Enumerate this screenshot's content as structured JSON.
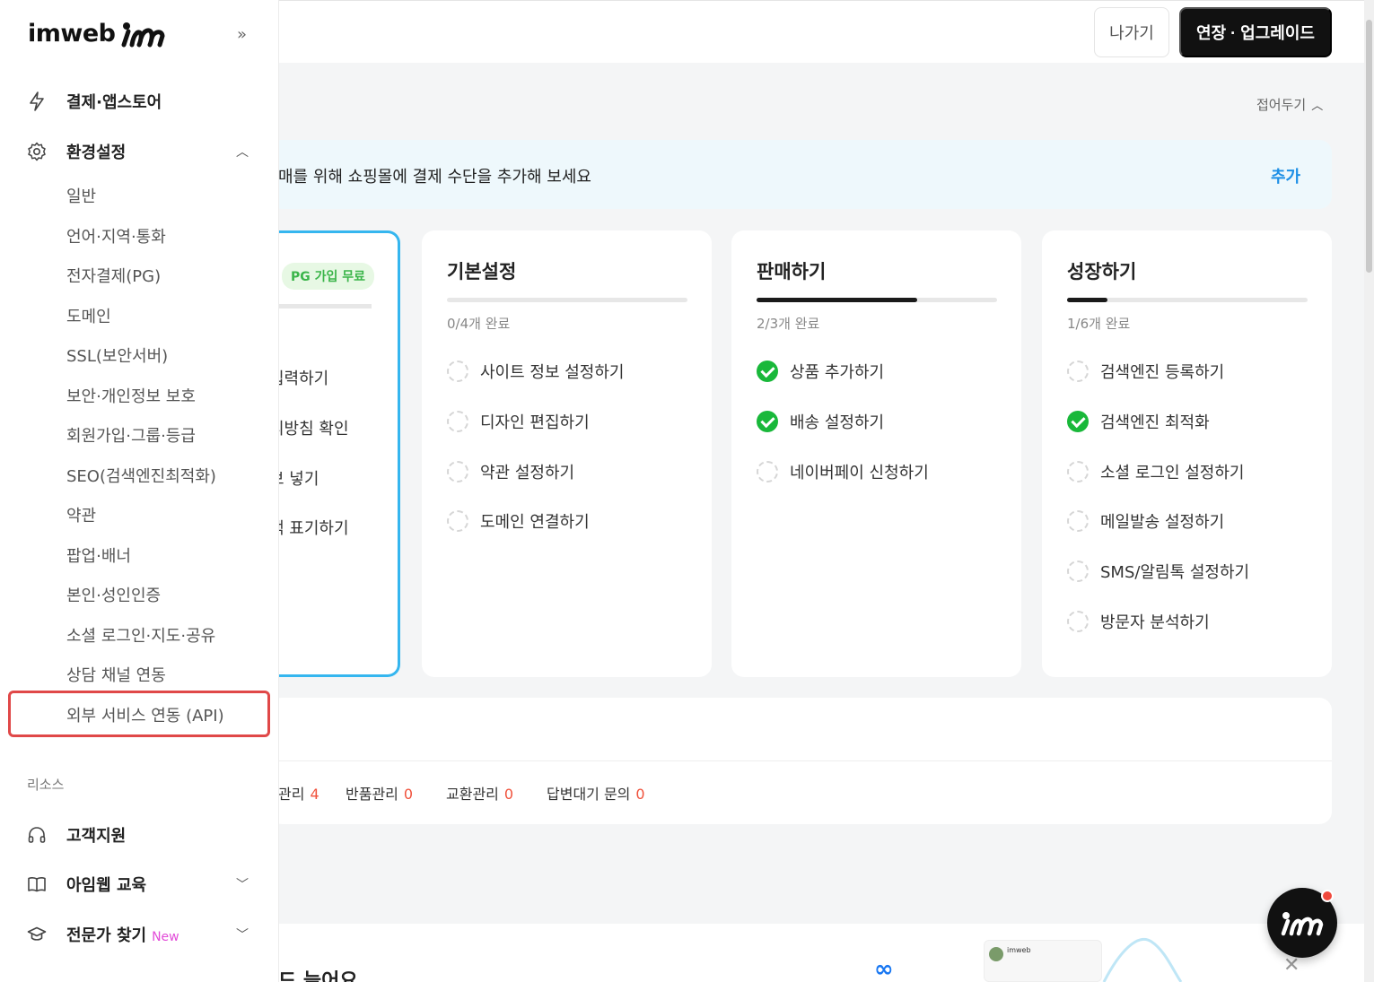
{
  "header": {
    "exit_label": "나가기",
    "upgrade_label": "연장 · 업그레이드"
  },
  "sidebar": {
    "logo_text": "imweb",
    "menu": [
      {
        "label": "결제·앱스토어",
        "icon": "bolt-icon"
      },
      {
        "label": "환경설정",
        "icon": "gear-icon",
        "expanded": true
      }
    ],
    "settings_items": [
      "일반",
      "언어·지역·통화",
      "전자결제(PG)",
      "도메인",
      "SSL(보안서버)",
      "보안·개인정보 보호",
      "회원가입·그룹·등급",
      "SEO(검색엔진최적화)",
      "약관",
      "팝업·배너",
      "본인·성인인증",
      "소셜 로그인·지도·공유",
      "상담 채널 연동",
      "외부 서비스 연동 (API)"
    ],
    "resources_label": "리소스",
    "resources": [
      {
        "label": "고객지원",
        "icon": "headset-icon"
      },
      {
        "label": "아임웹 교육",
        "icon": "book-icon"
      },
      {
        "label": "전문가 찾기",
        "icon": "graduation-cap-icon",
        "badge": "New"
      }
    ]
  },
  "main": {
    "collapse_label": "접어두기",
    "banner_text": "매를 위해 쇼핑몰에 결제 수단을 추가해 보세요",
    "banner_action": "추가",
    "pg_card": {
      "badge": "PG 가입 무료",
      "tasks": [
        "입력하기",
        "리방침 확인",
        "보 넣기",
        "백 표기하기"
      ]
    },
    "cards": [
      {
        "title": "기본설정",
        "progress": 0,
        "count": "0/4개 완료",
        "tasks": [
          {
            "label": "사이트 정보 설정하기",
            "done": false
          },
          {
            "label": "디자인 편집하기",
            "done": false
          },
          {
            "label": "약관 설정하기",
            "done": false
          },
          {
            "label": "도메인 연결하기",
            "done": false
          }
        ]
      },
      {
        "title": "판매하기",
        "progress": 0.667,
        "count": "2/3개 완료",
        "tasks": [
          {
            "label": "상품 추가하기",
            "done": true
          },
          {
            "label": "배송 설정하기",
            "done": true
          },
          {
            "label": "네이버페이 신청하기",
            "done": false
          }
        ]
      },
      {
        "title": "성장하기",
        "progress": 0.167,
        "count": "1/6개 완료",
        "tasks": [
          {
            "label": "검색엔진 등록하기",
            "done": false
          },
          {
            "label": "검색엔진 최적화",
            "done": true
          },
          {
            "label": "소셜 로그인 설정하기",
            "done": false
          },
          {
            "label": "메일발송 설정하기",
            "done": false
          },
          {
            "label": "SMS/알림톡 설정하기",
            "done": false
          },
          {
            "label": "방문자 분석하기",
            "done": false
          }
        ]
      }
    ],
    "orders": [
      {
        "label": "관리",
        "count": "4"
      },
      {
        "label": "반품관리",
        "count": "0"
      },
      {
        "label": "교환관리",
        "count": "0"
      },
      {
        "label": "답변대기 문의",
        "count": "0"
      }
    ],
    "bottom_title": "드 늘어요",
    "ad_name": "imweb"
  },
  "colors": {
    "accent_blue": "#1d8fe6",
    "pg_border": "#35b6ef",
    "done_green": "#19b83a",
    "count_red": "#f0523c",
    "highlight_red": "#e04848",
    "new_pink": "#e24bd8"
  }
}
